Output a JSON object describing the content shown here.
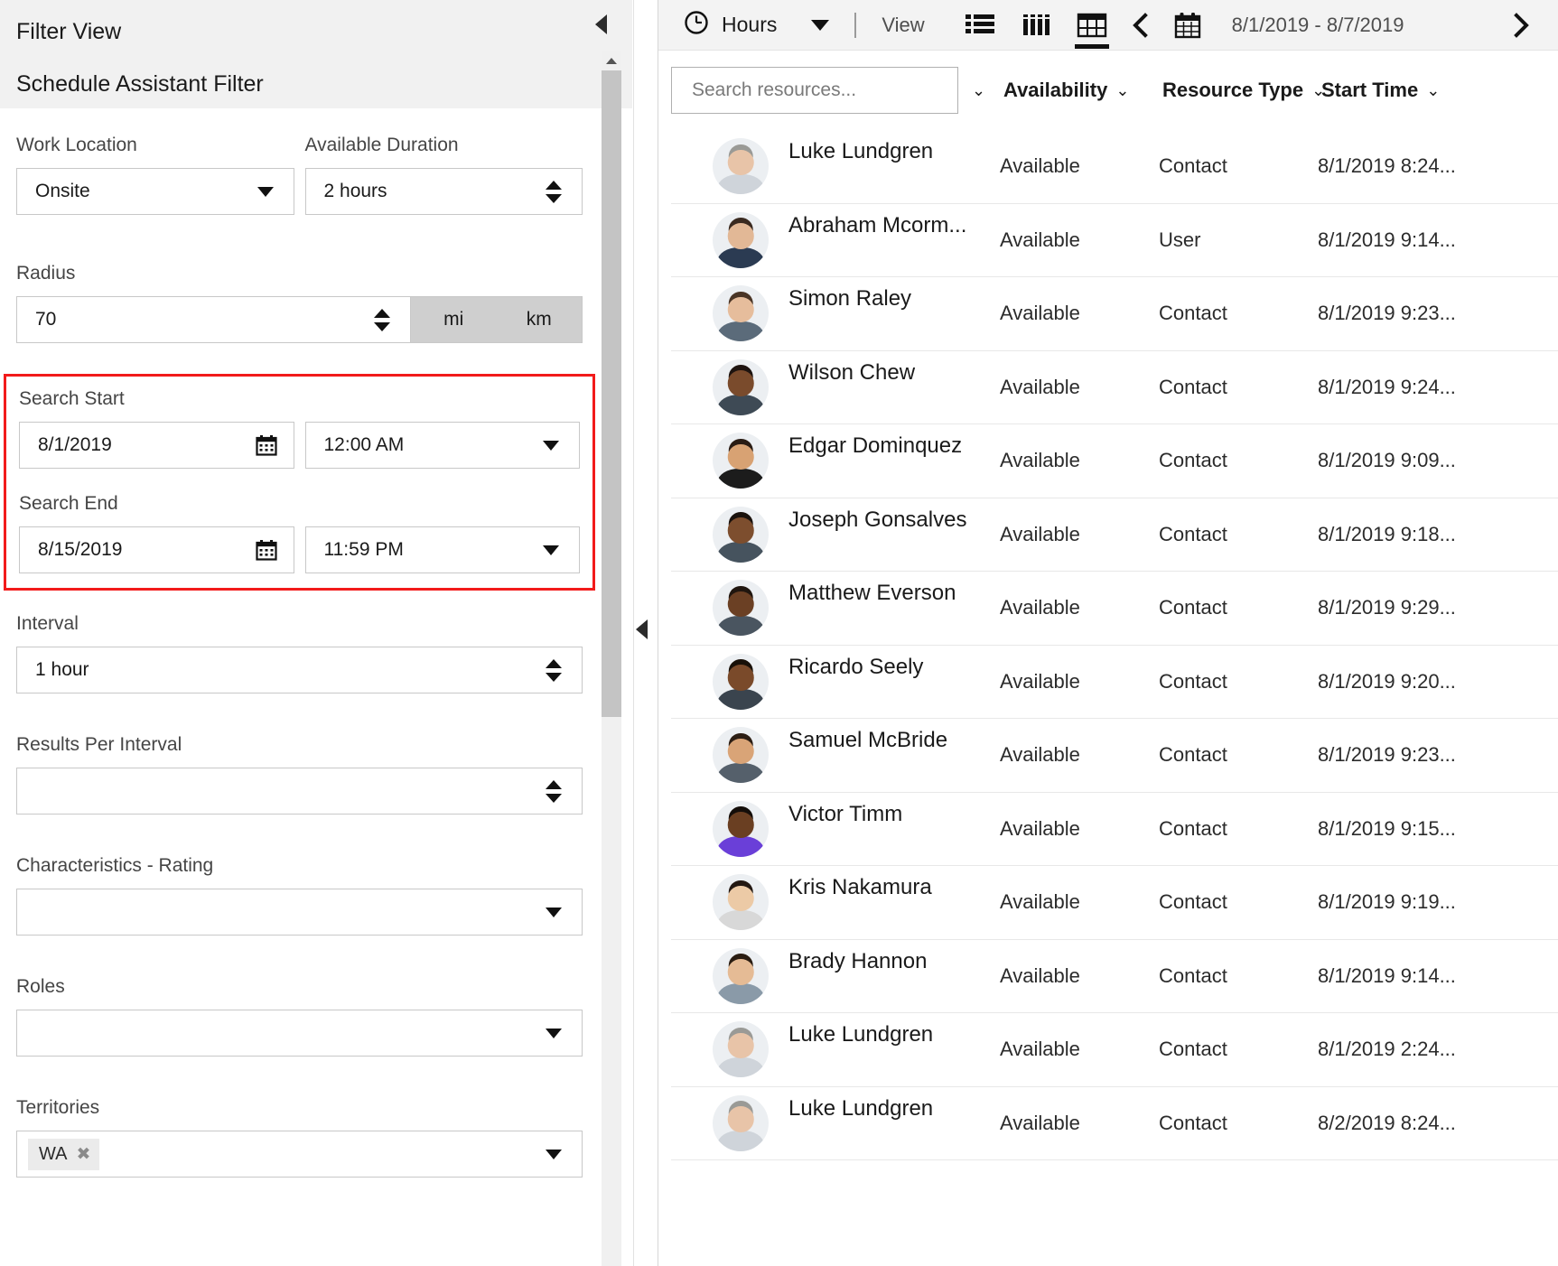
{
  "left_panel": {
    "title": "Filter View",
    "subtitle": "Schedule Assistant Filter",
    "collapse_icon": "chevron-left-icon",
    "fields": {
      "work_location": {
        "label": "Work Location",
        "value": "Onsite"
      },
      "available_duration": {
        "label": "Available Duration",
        "value": "2 hours"
      },
      "radius": {
        "label": "Radius",
        "value": "70",
        "unit_mi": "mi",
        "unit_km": "km",
        "selected_unit": "mi"
      },
      "search_start": {
        "label": "Search Start",
        "date": "8/1/2019",
        "time": "12:00 AM"
      },
      "search_end": {
        "label": "Search End",
        "date": "8/15/2019",
        "time": "11:59 PM"
      },
      "interval": {
        "label": "Interval",
        "value": "1 hour"
      },
      "results_per_interval": {
        "label": "Results Per Interval",
        "value": ""
      },
      "characteristics_rating": {
        "label": "Characteristics - Rating",
        "value": ""
      },
      "roles": {
        "label": "Roles",
        "value": ""
      },
      "territories": {
        "label": "Territories",
        "tokens": [
          "WA"
        ]
      }
    },
    "highlight_color": "#f21b1b"
  },
  "splitter": {
    "icon": "chevron-left-icon"
  },
  "toolbar": {
    "clock_icon": "clock-icon",
    "hours_label": "Hours",
    "hours_caret_icon": "caret-down-icon",
    "separator": "|",
    "view_label": "View",
    "view_icons": [
      {
        "name": "list-view-icon",
        "active": false
      },
      {
        "name": "columns-view-icon",
        "active": false
      },
      {
        "name": "grid-view-icon",
        "active": true
      }
    ],
    "prev_icon": "chevron-left-icon",
    "calendar_icon": "calendar-icon",
    "date_range": "8/1/2019 - 8/7/2019",
    "next_icon": "chevron-right-icon"
  },
  "grid": {
    "search_placeholder": "Search resources...",
    "headers": [
      {
        "label": "",
        "caret": "⌄"
      },
      {
        "label": "Availability",
        "caret": "⌄"
      },
      {
        "label": "Resource Type",
        "caret": "⌄"
      },
      {
        "label": "Start Time",
        "caret": "⌄"
      }
    ],
    "rows": [
      {
        "name": "Luke Lundgren",
        "availability": "Available",
        "type": "Contact",
        "start": "8/1/2019 8:24...",
        "skin": "#e8c4a8",
        "hair": "#9a9a96",
        "shirt": "#cfd4da"
      },
      {
        "name": "Abraham Mcorm...",
        "availability": "Available",
        "type": "User",
        "start": "8/1/2019 9:14...",
        "skin": "#e2b896",
        "hair": "#3a2a20",
        "shirt": "#2b3b52"
      },
      {
        "name": "Simon Raley",
        "availability": "Available",
        "type": "Contact",
        "start": "8/1/2019 9:23...",
        "skin": "#e6bd9c",
        "hair": "#4a3526",
        "shirt": "#5b6b7a"
      },
      {
        "name": "Wilson Chew",
        "availability": "Available",
        "type": "Contact",
        "start": "8/1/2019 9:24...",
        "skin": "#7a4b2c",
        "hair": "#1e1410",
        "shirt": "#3e4a55"
      },
      {
        "name": "Edgar Dominquez",
        "availability": "Available",
        "type": "Contact",
        "start": "8/1/2019 9:09...",
        "skin": "#d8a273",
        "hair": "#2a1c14",
        "shirt": "#1c1c1c"
      },
      {
        "name": "Joseph Gonsalves",
        "availability": "Available",
        "type": "Contact",
        "start": "8/1/2019 9:18...",
        "skin": "#7d4e2e",
        "hair": "#1a120d",
        "shirt": "#46535e"
      },
      {
        "name": "Matthew Everson",
        "availability": "Available",
        "type": "Contact",
        "start": "8/1/2019 9:29...",
        "skin": "#6b4024",
        "hair": "#20160f",
        "shirt": "#4a5560"
      },
      {
        "name": "Ricardo Seely",
        "availability": "Available",
        "type": "Contact",
        "start": "8/1/2019 9:20...",
        "skin": "#7a4a2a",
        "hair": "#181008",
        "shirt": "#3a444e"
      },
      {
        "name": "Samuel McBride",
        "availability": "Available",
        "type": "Contact",
        "start": "8/1/2019 9:23...",
        "skin": "#d9a477",
        "hair": "#2c1e14",
        "shirt": "#55606b"
      },
      {
        "name": "Victor Timm",
        "availability": "Available",
        "type": "Contact",
        "start": "8/1/2019 9:15...",
        "skin": "#6a3f22",
        "hair": "#140e0a",
        "shirt": "#6a3fd8"
      },
      {
        "name": "Kris Nakamura",
        "availability": "Available",
        "type": "Contact",
        "start": "8/1/2019 9:19...",
        "skin": "#eccaa6",
        "hair": "#231812",
        "shirt": "#d8d8d8"
      },
      {
        "name": "Brady Hannon",
        "availability": "Available",
        "type": "Contact",
        "start": "8/1/2019 9:14...",
        "skin": "#e5bb95",
        "hair": "#2a1d12",
        "shirt": "#8a9aa8"
      },
      {
        "name": "Luke Lundgren",
        "availability": "Available",
        "type": "Contact",
        "start": "8/1/2019 2:24...",
        "skin": "#e8c4a8",
        "hair": "#9a9a96",
        "shirt": "#cfd4da"
      },
      {
        "name": "Luke Lundgren",
        "availability": "Available",
        "type": "Contact",
        "start": "8/2/2019 8:24...",
        "skin": "#e8c4a8",
        "hair": "#9a9a96",
        "shirt": "#cfd4da"
      }
    ]
  }
}
